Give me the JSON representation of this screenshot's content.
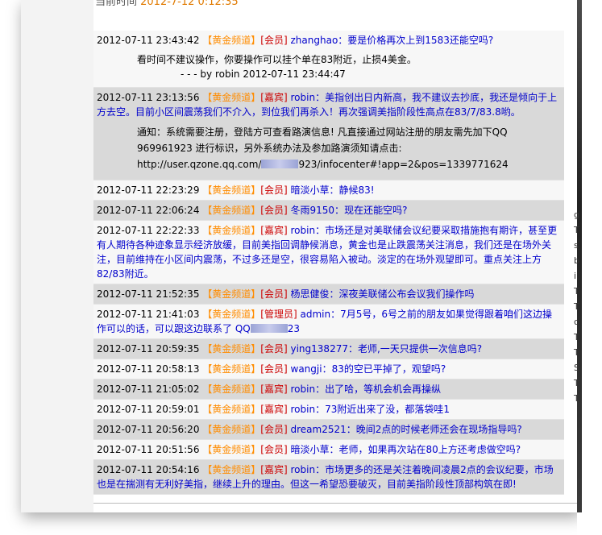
{
  "header": {
    "clipped_text": "当前时间 ",
    "clipped_time": "2012-7-12 0:12:35"
  },
  "messages": [
    {
      "ts": "2012-07-11 23:43:42",
      "channel": "【黄金频道】",
      "role": "[会员]",
      "name": "zhanghao",
      "text": "要是价格再次上到1583还能空吗?",
      "reply": "看时间不建议操作，你要操作可以挂个单在83附近，止损4美金。",
      "reply_by": "- - - by robin  2012-07-11 23:44:47"
    },
    {
      "ts": "2012-07-11 23:13:56",
      "channel": "【黄金频道】",
      "role": "[嘉宾]",
      "name": "robin",
      "text": "美指创出日内新高，我不建议去抄底，我还是倾向于上方去空。目前小区间震荡我们不介入，到位我们再杀入！再次强调美指阶段性高点在83/7/83.8哟。",
      "notice_1": "通知：系统需要注册，登陆方可查看路演信息! 凡直接通过网站注册的朋友需先加下QQ",
      "notice_2": "969961923 进行标识，另外系统办法及参加路演须知请点击:",
      "notice_3a": "http://user.qzone.qq.com/",
      "notice_3b": "923/infocenter#!app=2&pos=1339771624"
    },
    {
      "ts": "2012-07-11 22:23:29",
      "channel": "【黄金频道】",
      "role": "[会员]",
      "name": "暗淡小草",
      "text": "静候83!"
    },
    {
      "ts": "2012-07-11 22:06:24",
      "channel": "【黄金频道】",
      "role": "[会员]",
      "name": "冬雨9150",
      "text": "现在还能空吗?"
    },
    {
      "ts": "2012-07-11 22:22:33",
      "channel": "【黄金频道】",
      "role": "[嘉宾]",
      "name": "robin",
      "text": "市场还是对美联储会议纪要采取措施抱有期许，甚至更有人期待各种迹象显示经济放缓，目前美指回调静候消息，黄金也是止跌震荡关注消息，我们还是在场外关注，目前维持在小区间内震荡，不过多还是空，很容易陷入被动。淡定的在场外观望即可。重点关注上方82/83附近。"
    },
    {
      "ts": "2012-07-11 21:52:35",
      "channel": "【黄金频道】",
      "role": "[会员]",
      "name": "杨思健俊",
      "text": "深夜美联储公布会议我们操作吗"
    },
    {
      "ts": "2012-07-11 21:41:03",
      "channel": "【黄金频道】",
      "role": "[管理员]",
      "name": "admin",
      "text": "7月5号，6号之前的朋友如果觉得跟着咱们这边操作可以的话，可以跟这边联系了 QQ",
      "text_tail": "23"
    },
    {
      "ts": "2012-07-11 20:59:35",
      "channel": "【黄金频道】",
      "role": "[会员]",
      "name": "ying138277",
      "text": "老师,一天只提供一次信息吗?"
    },
    {
      "ts": "2012-07-11 20:58:13",
      "channel": "【黄金频道】",
      "role": "[会员]",
      "name": "wangji",
      "text": "83的空已平掉了，观望吗?"
    },
    {
      "ts": "2012-07-11 21:05:02",
      "channel": "【黄金频道】",
      "role": "[嘉宾]",
      "name": "robin",
      "text": "出了哈，等机会机会再操纵"
    },
    {
      "ts": "2012-07-11 20:59:01",
      "channel": "【黄金频道】",
      "role": "[嘉宾]",
      "name": "robin",
      "text": "73附近出来了没，都落袋哇1"
    },
    {
      "ts": "2012-07-11 20:56:20",
      "channel": "【黄金频道】",
      "role": "[会员]",
      "name": "dream2521",
      "text": "晚间2点的时候老师还会在现场指导吗?"
    },
    {
      "ts": "2012-07-11 20:51:56",
      "channel": "【黄金频道】",
      "role": "[会员]",
      "name": "暗淡小草",
      "text": "老师，如果再次站在80上方还考虑做空吗?"
    },
    {
      "ts": "2012-07-11 20:54:16",
      "channel": "【黄金频道】",
      "role": "[嘉宾]",
      "name": "robin",
      "text": "市场更多的还是关注着晚间凌晨2点的会议纪要，市场也是在揣测有无利好美指，继续上升的理由。但这一希望恐要破灭，目前美指阶段性顶部构筑在即!"
    }
  ],
  "side_chars": [
    "g",
    "T",
    "s",
    "b",
    "i",
    "T",
    "T",
    "c",
    "T",
    "T",
    "S",
    "T",
    "T"
  ],
  "colors": {
    "channel": "#ff8c00",
    "role": "#cc0000",
    "name": "#0000cc",
    "row_gray": "#d9d9d9",
    "row_white": "#f7f7f7"
  },
  "icons": {
    "scroll_up": "chevron-up-icon",
    "scroll_down": "chevron-down-icon"
  }
}
